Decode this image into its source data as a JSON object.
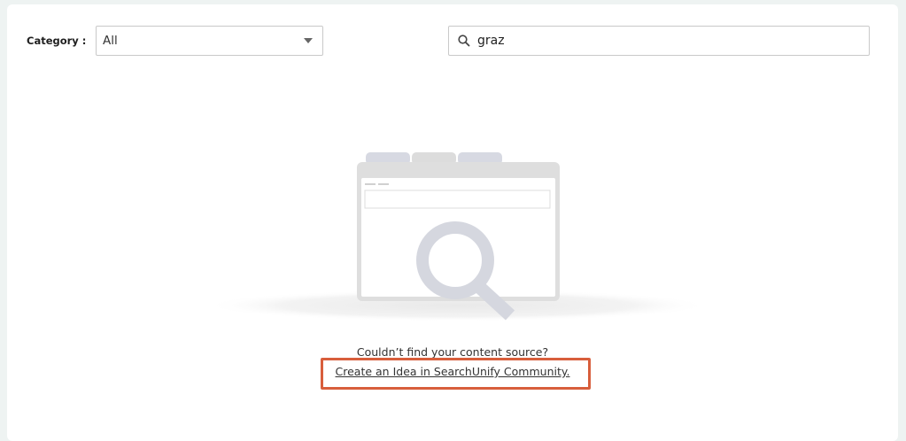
{
  "filters": {
    "category_label": "Category :",
    "category_value": "All"
  },
  "search": {
    "value": "graz"
  },
  "empty_state": {
    "message": "Couldn’t find your content source?",
    "link_text": "Create an Idea in SearchUnify Community."
  },
  "colors": {
    "highlight_border": "#d85e3c",
    "illustration_gray": "#d7d9e2"
  }
}
